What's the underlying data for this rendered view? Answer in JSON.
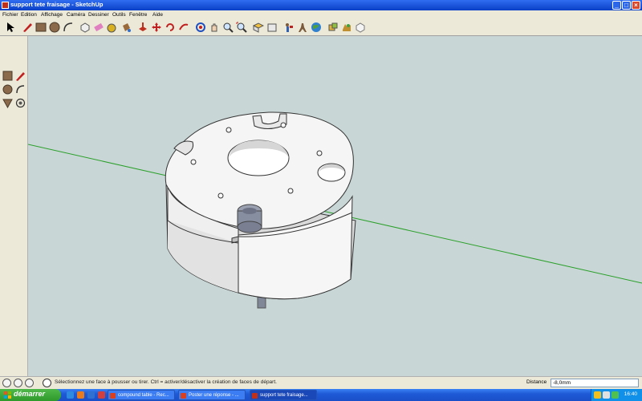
{
  "window": {
    "title": "support tete fraisage - SketchUp"
  },
  "menu": [
    "Fichier",
    "Edition",
    "Affichage",
    "Caméra",
    "Dessiner",
    "Outils",
    "Fenêtre",
    "Aide"
  ],
  "toolbar": {
    "icons": [
      "select-icon",
      "pencil-icon",
      "rectangle-icon",
      "circle-icon",
      "arc-icon",
      "make-component-icon",
      "eraser-icon",
      "tape-measure-icon",
      "paint-bucket-icon",
      "push-pull-icon",
      "move-icon",
      "rotate-icon",
      "follow-me-icon",
      "orbit-icon",
      "pan-icon",
      "zoom-icon",
      "zoom-extents-icon",
      "top-view-icon",
      "iso-view-icon",
      "position-camera-icon",
      "walk-icon",
      "get-models-icon",
      "share-model-icon",
      "components-icon",
      "model-info-icon"
    ]
  },
  "left_palette": {
    "icons": [
      "rectangle-icon",
      "pencil-icon",
      "circle-icon",
      "arc-icon",
      "push-pull-icon",
      "orbit-icon"
    ]
  },
  "status": {
    "message": "Sélectionnez une face à pousser ou tirer.  Ctrl = activer/désactiver la création de faces de départ.",
    "distance_label": "Distance",
    "distance_value": "-8,0mm"
  },
  "taskbar": {
    "start_label": "démarrer",
    "tasks": [
      {
        "label": "compound table - Rec...",
        "active": false,
        "icon_color": "#d84020"
      },
      {
        "label": "Poster une réponse - ...",
        "active": false,
        "icon_color": "#d84020"
      },
      {
        "label": "support tete fraisage...",
        "active": true,
        "icon_color": "#c03018"
      }
    ],
    "clock": "16:40"
  },
  "colors": {
    "viewport": "#c9d6d6",
    "part_face": "#f2f2f2",
    "axis_green": "#2aa02a"
  }
}
